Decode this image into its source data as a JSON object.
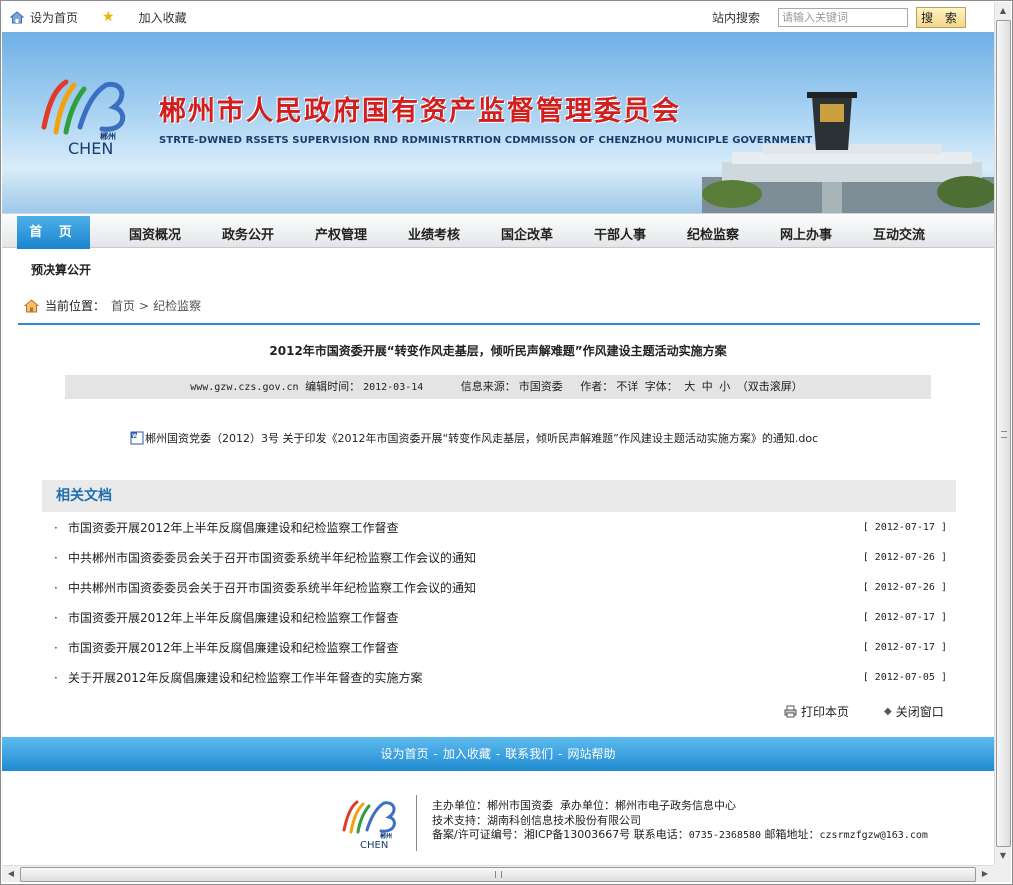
{
  "topbar": {
    "home_link": "设为首页",
    "favorite_link": "加入收藏",
    "search_label": "站内搜索",
    "search_placeholder": "请输入关键词",
    "search_button": "搜 索"
  },
  "banner": {
    "title": "郴州市人民政府国有资产监督管理委员会",
    "subtitle": "STRTE-DWNED RSSETS SUPERVISION RND RDMINISTRRTION CDMMISSON OF CHENZHOU MUNICIPLE GOVERNMENT",
    "logo_text": "CHEN",
    "logo_sub": "郴州"
  },
  "nav": {
    "items": [
      "首 页",
      "国资概况",
      "政务公开",
      "产权管理",
      "业绩考核",
      "国企改革",
      "干部人事",
      "纪检监察",
      "网上办事",
      "互动交流"
    ]
  },
  "subnav": {
    "label": "预决算公开"
  },
  "breadcrumb": {
    "label": "当前位置：",
    "home": "首页",
    "separator": ">",
    "current": "纪检监察"
  },
  "article": {
    "title": "2012年市国资委开展“转变作风走基层，倾听民声解难题”作风建设主题活动实施方案",
    "meta": {
      "site": "www.gzw.czs.gov.cn",
      "edit_time_label": "编辑时间：",
      "edit_time": "2012-03-14",
      "source_label": "信息来源：",
      "source": "市国资委",
      "author_label": "作者：",
      "author": "不详",
      "font_label": "字体：",
      "font_large": "大",
      "font_medium": "中",
      "font_small": "小",
      "scroll": "（双击滚屏）"
    },
    "attachment": "郴州国资党委（2012）3号 关于印发《2012年市国资委开展“转变作风走基层，倾听民声解难题”作风建设主题活动实施方案》的通知.doc"
  },
  "related": {
    "heading": "相关文档",
    "bullet": "·",
    "items": [
      {
        "title": "市国资委开展2012年上半年反腐倡廉建设和纪检监察工作督查",
        "date": "[ 2012-07-17 ]"
      },
      {
        "title": "中共郴州市国资委委员会关于召开市国资委系统半年纪检监察工作会议的通知",
        "date": "[ 2012-07-26 ]"
      },
      {
        "title": "中共郴州市国资委委员会关于召开市国资委系统半年纪检监察工作会议的通知",
        "date": "[ 2012-07-26 ]"
      },
      {
        "title": "市国资委开展2012年上半年反腐倡廉建设和纪检监察工作督查",
        "date": "[ 2012-07-17 ]"
      },
      {
        "title": "市国资委开展2012年上半年反腐倡廉建设和纪检监察工作督查",
        "date": "[ 2012-07-17 ]"
      },
      {
        "title": "关于开展2012年反腐倡廉建设和纪检监察工作半年督查的实施方案",
        "date": "[ 2012-07-05 ]"
      }
    ]
  },
  "actions": {
    "print": "打印本页",
    "close": "关闭窗口"
  },
  "footbar": {
    "links": [
      "设为首页",
      "加入收藏",
      "联系我们",
      "网站帮助"
    ],
    "separator": "-"
  },
  "footer": {
    "host_label": "主办单位：",
    "host": "郴州市国资委",
    "organizer_label": "承办单位：",
    "organizer": "郴州市电子政务信息中心",
    "tech_label": "技术支持：",
    "tech": "湖南科创信息技术股份有限公司",
    "icp_label": "备案/许可证编号：",
    "icp": "湘ICP备13003667号",
    "phone_label": "联系电话：",
    "phone": "0735-2368580",
    "email_label": "邮箱地址：",
    "email": "czsrmzfgzw@163.com"
  },
  "colors": {
    "nav_active": "#1a84cf",
    "title_red": "#d11e1e",
    "accent_blue": "#2d8bd0",
    "related_head": "#1f6fae"
  }
}
